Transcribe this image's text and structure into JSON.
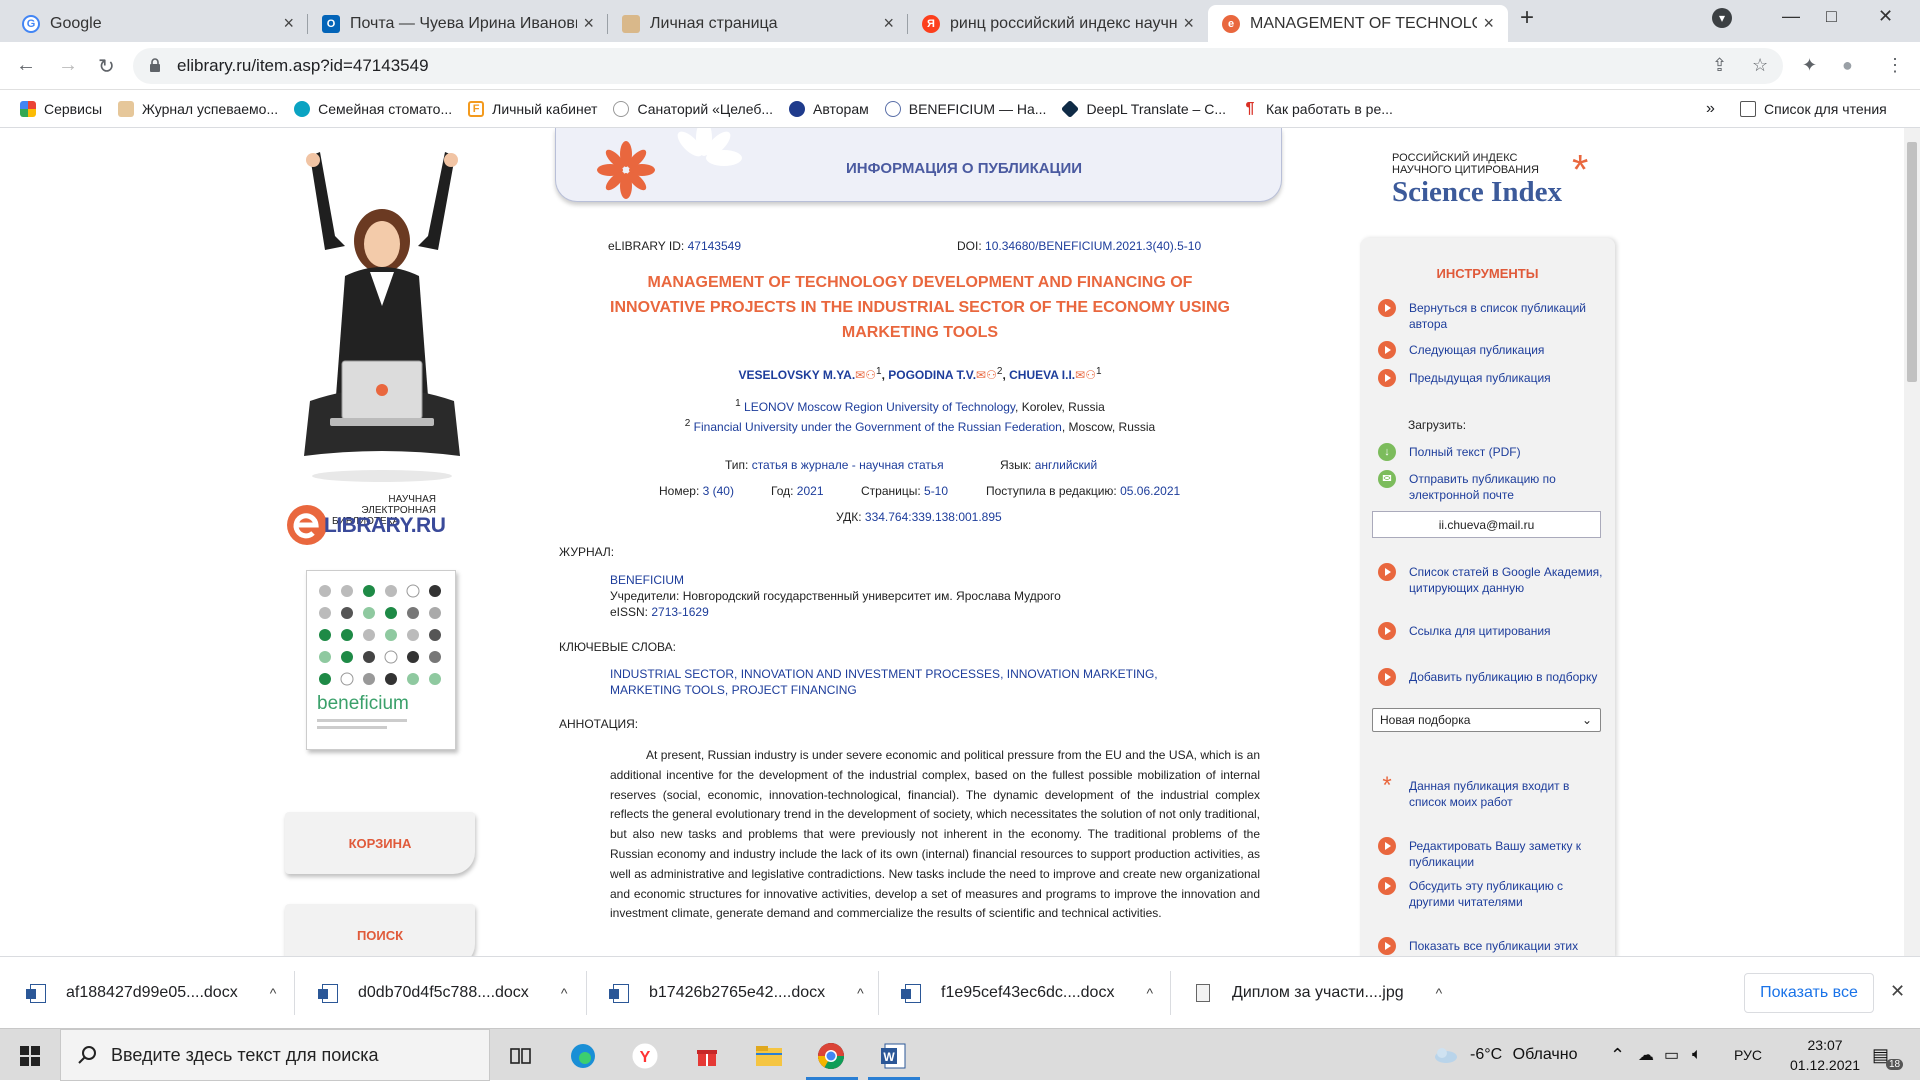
{
  "tabs": [
    {
      "title": "Google",
      "favicon": "google-icon",
      "close": "×"
    },
    {
      "title": "Почта — Чуева Ирина Ивановн",
      "favicon": "outlook-icon",
      "close": "×"
    },
    {
      "title": "Личная страница",
      "favicon": "hat-icon",
      "close": "×"
    },
    {
      "title": "ринц российский индекс научн",
      "favicon": "yandex-icon",
      "close": "×"
    },
    {
      "title": "MANAGEMENT OF TECHNOLOG",
      "favicon": "elibrary-icon",
      "close": "×"
    }
  ],
  "window": {
    "new_tab": "+",
    "minimize": "—",
    "maximize": "□",
    "close": "✕",
    "profile_menu": "▾"
  },
  "address": {
    "url": "elibrary.ru/item.asp?id=47143549",
    "back": "←",
    "forward": "→",
    "reload": "↻",
    "share": "⇪",
    "star": "☆",
    "ext": "✦",
    "avatar": "●",
    "menu": "⋮"
  },
  "bookmarks": [
    {
      "label": "Сервисы",
      "icon": "apps-grid-icon"
    },
    {
      "label": "Журнал успеваемо...",
      "icon": "hat-icon"
    },
    {
      "label": "Семейная стомато...",
      "icon": "tooth-icon"
    },
    {
      "label": "Личный кабинет",
      "icon": "f-bracket-icon"
    },
    {
      "label": "Санаторий «Целеб...",
      "icon": "sanatorium-icon"
    },
    {
      "label": "Авторам",
      "icon": "authors-icon"
    },
    {
      "label": "BENEFICIUM — На...",
      "icon": "beneficium-icon"
    },
    {
      "label": "DeepL Translate – C...",
      "icon": "deepl-icon"
    },
    {
      "label": "Как работать в ре...",
      "icon": "pilcrow-icon"
    }
  ],
  "bookmarks_more": "»",
  "reading_list": "Список для чтения",
  "left": {
    "elibrary_logo_line1": "НАУЧНАЯ ЭЛЕКТРОННАЯ",
    "elibrary_logo_line2": "БИБЛИОТЕКА",
    "elibrary_logo_brand": "LIBRARY.RU",
    "cover_title": "beneficium",
    "cart_button": "КОРЗИНА",
    "search_button": "ПОИСК"
  },
  "header": {
    "title": "ИНФОРМАЦИЯ О ПУБЛИКАЦИИ"
  },
  "pub": {
    "id_label": "eLIBRARY ID:",
    "id_value": "47143549",
    "doi_label": "DOI:",
    "doi_value": "10.34680/BENEFICIUM.2021.3(40).5-10",
    "title_line1": "MANAGEMENT OF TECHNOLOGY DEVELOPMENT AND FINANCING OF",
    "title_line2": "INNOVATIVE PROJECTS IN THE INDUSTRIAL SECTOR OF THE ECONOMY USING",
    "title_line3": "MARKETING TOOLS",
    "authors": [
      {
        "name": "VESELOVSKY M.YA.",
        "sup": "1",
        "sep": ","
      },
      {
        "name": "POGODINA T.V.",
        "sup": "2",
        "sep": ","
      },
      {
        "name": "CHUEVA I.I.",
        "sup": "1",
        "sep": ""
      }
    ],
    "affiliations": [
      {
        "sup": "1",
        "org": "LEONOV Moscow Region University of Technology",
        "place": ", Korolev, Russia"
      },
      {
        "sup": "2",
        "org": "Financial University under the Government of the Russian Federation",
        "place": ", Moscow, Russia"
      }
    ],
    "type_label": "Тип:",
    "type_value": "статья в журнале - научная статья",
    "lang_label": "Язык:",
    "lang_value": "английский",
    "number_label": "Номер:",
    "number_value": "3 (40)",
    "year_label": "Год:",
    "year_value": "2021",
    "pages_label": "Страницы:",
    "pages_value": "5-10",
    "received_label": "Поступила в редакцию:",
    "received_value": "05.06.2021",
    "udk_label": "УДК:",
    "udk_value": "334.764:339.138:001.895",
    "journal_heading": "ЖУРНАЛ:",
    "journal_name": "BENEFICIUM",
    "founder_label": "Учредители:",
    "founder_value": "Новгородский государственный университет им. Ярослава Мудрого",
    "eissn_label": "eISSN:",
    "eissn_value": "2713-1629",
    "keywords_heading": "КЛЮЧЕВЫЕ СЛОВА:",
    "keywords_line1": "INDUSTRIAL SECTOR, INNOVATION AND INVESTMENT PROCESSES, INNOVATION MARKETING,",
    "keywords_line2": "MARKETING TOOLS, PROJECT FINANCING",
    "abstract_heading": "АННОТАЦИЯ:",
    "abstract": "At present, Russian industry is under severe economic and political pressure from the EU and the USA, which is an additional incentive for the development of the industrial complex, based on the fullest possible mobilization of internal reserves (social, economic, innovation-technological, financial). The dynamic development of the industrial complex reflects the general evolutionary trend in the development of society, which necessitates the solution of not only traditional, but also new tasks and problems that were previously not inherent in the economy. The traditional problems of the Russian economy and industry include the lack of its own (internal) financial resources to support production activities, as well as administrative and legislative contradictions. New tasks include the need to improve and create new organizational and economic structures for innovative activities, develop a set of measures and programs to improve the innovation and investment climate, generate demand and commercialize the results of scientific and technical activities."
  },
  "right": {
    "si_line1": "РОССИЙСКИЙ ИНДЕКС",
    "si_line2": "НАУЧНОГО ЦИТИРОВАНИЯ",
    "si_brand": "Science Index",
    "tools_title": "ИНСТРУМЕНТЫ",
    "back_to_list": "Вернуться в список публикаций автора",
    "next_pub": "Следующая публикация",
    "prev_pub": "Предыдущая публикация",
    "download_label": "Загрузить:",
    "full_text": "Полный текст (PDF)",
    "send_email": "Отправить публикацию по электронной почте",
    "email_value": "ii.chueva@mail.ru",
    "google_scholar": "Список статей в Google Академия, цитирующих данную",
    "cite_link": "Ссылка для цитирования",
    "add_to_collection": "Добавить публикацию в подборку",
    "collection_select": "Новая подборка",
    "in_my_works": "Данная публикация входит в список моих работ",
    "edit_note": "Редактировать Вашу заметку к публикации",
    "discuss": "Обсудить эту публикацию с другими читателями",
    "show_all_pubs": "Показать все публикации этих авторов"
  },
  "downloads": {
    "items": [
      {
        "name": "af188427d99e05....docx",
        "icon": "word-doc-icon"
      },
      {
        "name": "d0db70d4f5c788....docx",
        "icon": "word-doc-icon"
      },
      {
        "name": "b17426b2765e42....docx",
        "icon": "word-doc-icon"
      },
      {
        "name": "f1e95cef43ec6dc....docx",
        "icon": "word-doc-icon"
      },
      {
        "name": "Диплом за участи....jpg",
        "icon": "image-file-icon"
      }
    ],
    "chevron": "^",
    "show_all": "Показать все",
    "close": "✕"
  },
  "taskbar": {
    "search_placeholder": "Введите здесь текст для поиска",
    "weather_temp": "-6°C",
    "weather_text": "Облачно",
    "lang": "РУС",
    "time": "23:07",
    "date": "01.12.2021",
    "notifications": "18"
  },
  "colors": {
    "accent_orange": "#e9673e",
    "link_blue": "#1d3d9b",
    "header_blue": "#4a5aa0",
    "green": "#7cbc5c"
  }
}
